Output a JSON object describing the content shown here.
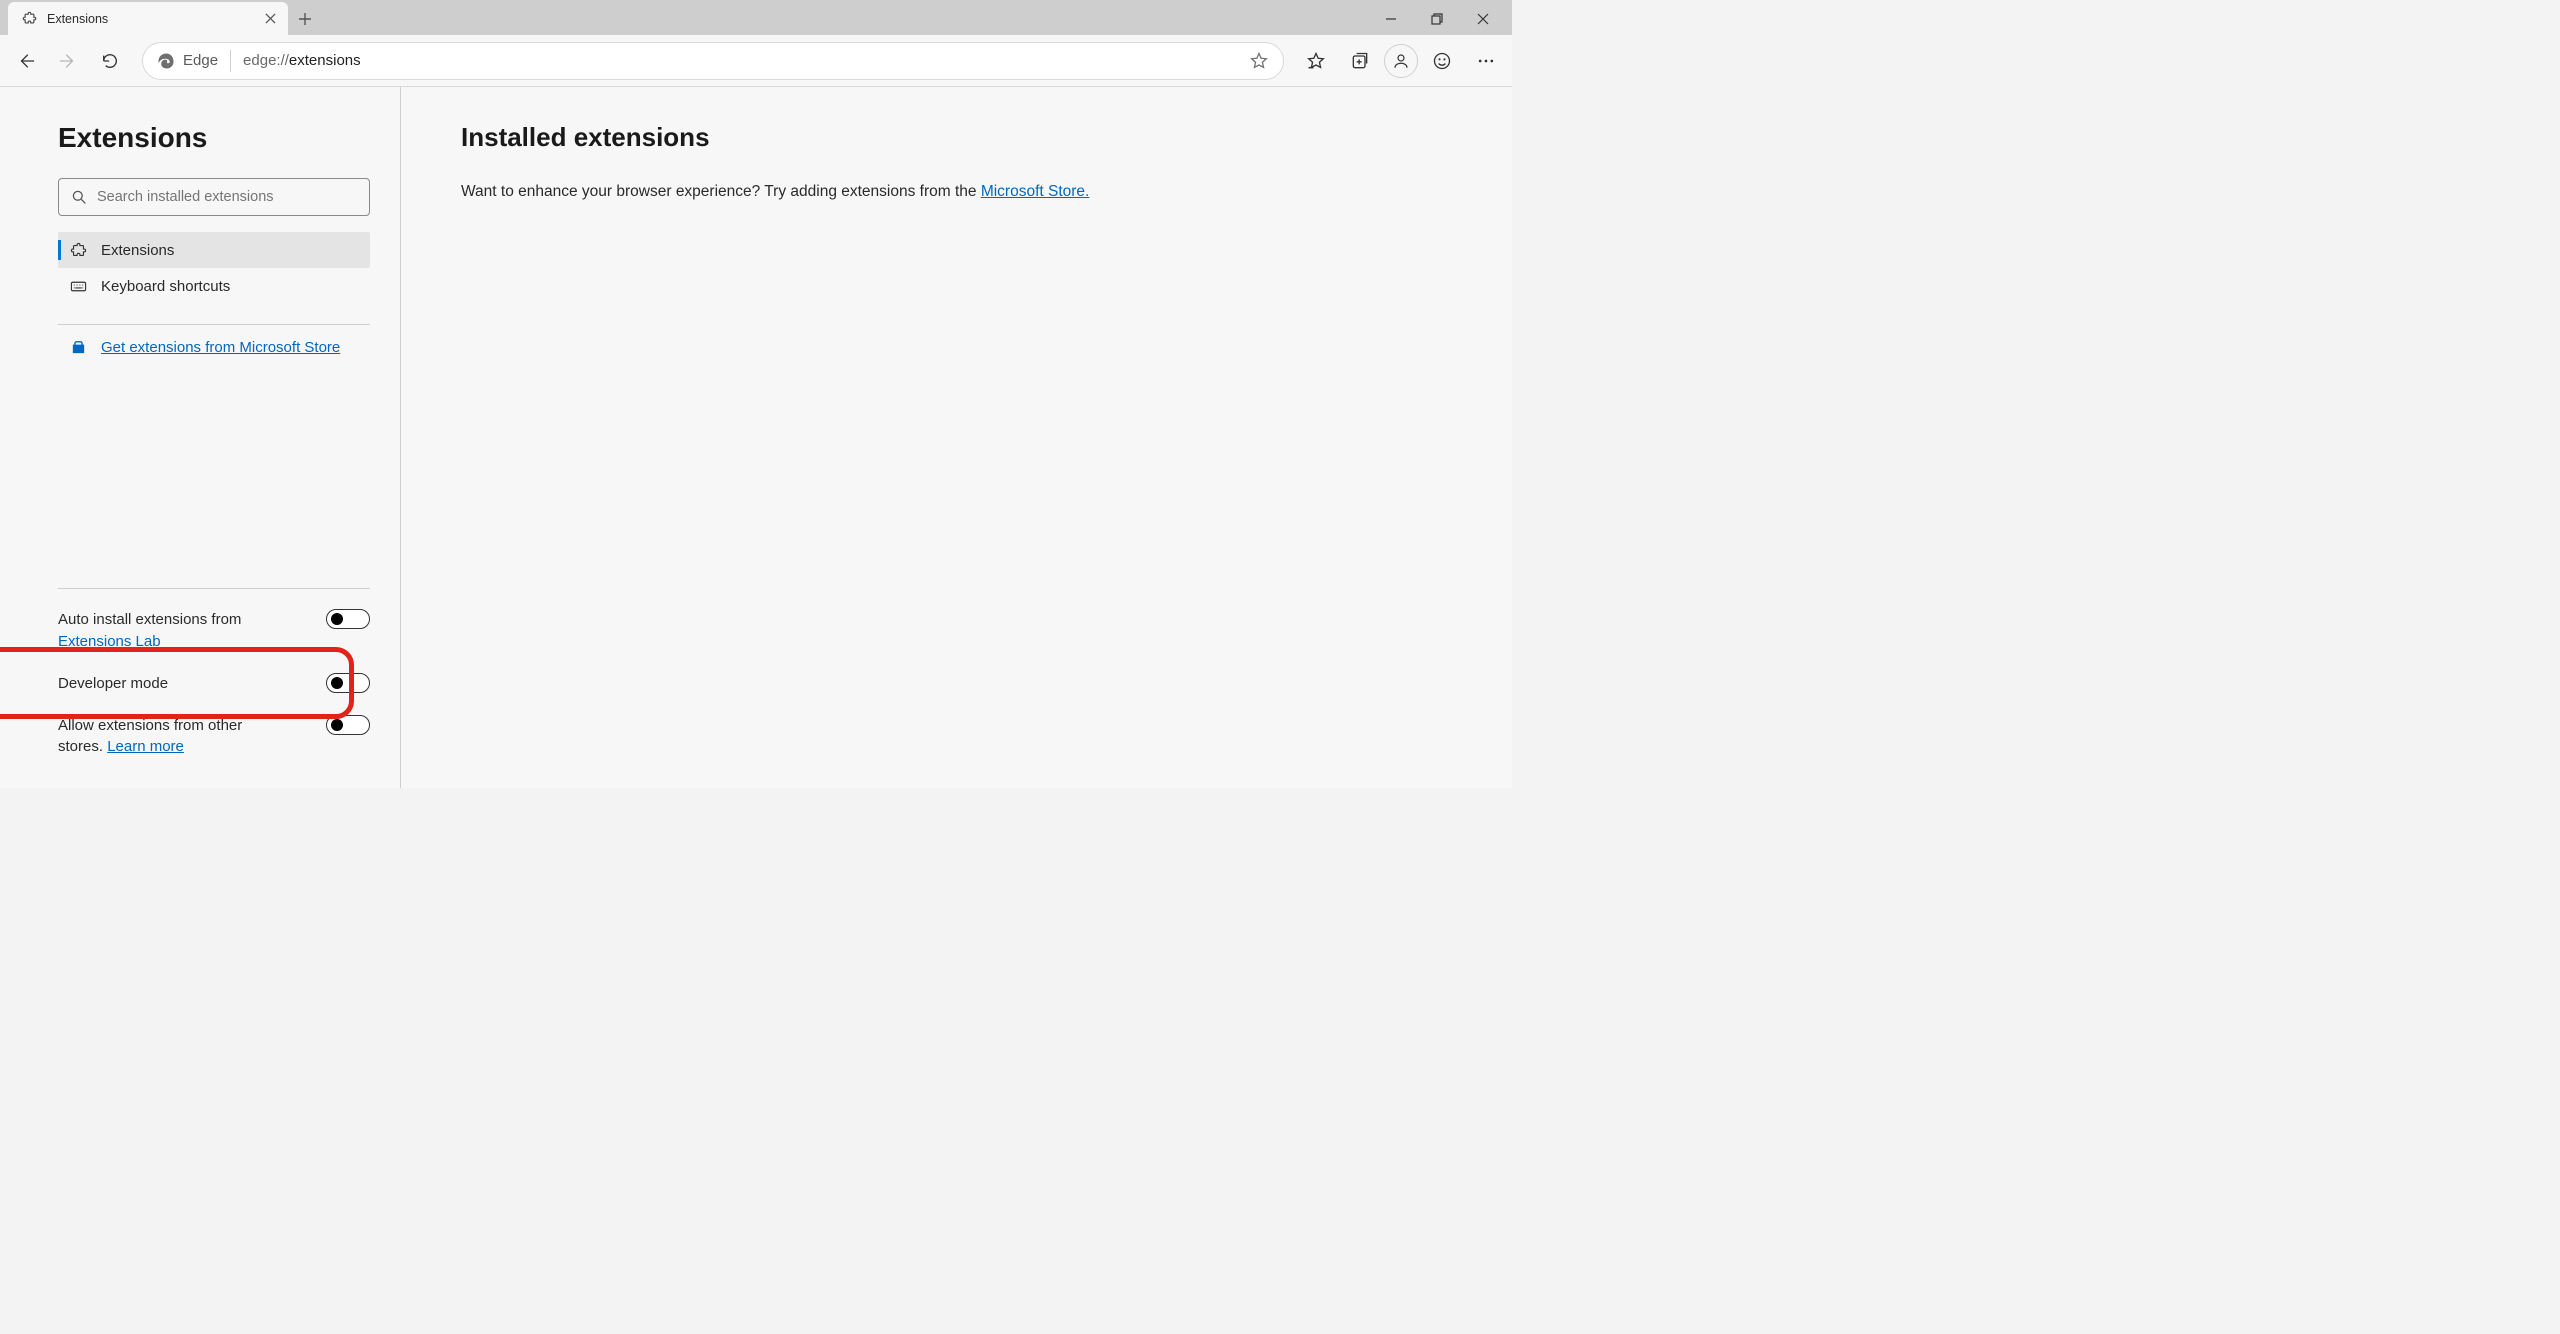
{
  "titlebar": {
    "tab_title": "Extensions"
  },
  "toolbar": {
    "edge_label": "Edge",
    "url_scheme": "edge://",
    "url_path": "extensions"
  },
  "sidebar": {
    "heading": "Extensions",
    "search_placeholder": "Search installed extensions",
    "nav": {
      "extensions": "Extensions",
      "shortcuts": "Keyboard shortcuts"
    },
    "store_link": "Get extensions from Microsoft Store",
    "toggles": {
      "auto_install_prefix": "Auto install extensions from ",
      "auto_install_link": "Extensions Lab",
      "developer_mode": "Developer mode",
      "other_stores_prefix": "Allow extensions from other stores. ",
      "other_stores_link": "Learn more"
    }
  },
  "main": {
    "heading": "Installed extensions",
    "prompt_prefix": "Want to enhance your browser experience? Try adding extensions from the ",
    "prompt_link": "Microsoft Store."
  }
}
